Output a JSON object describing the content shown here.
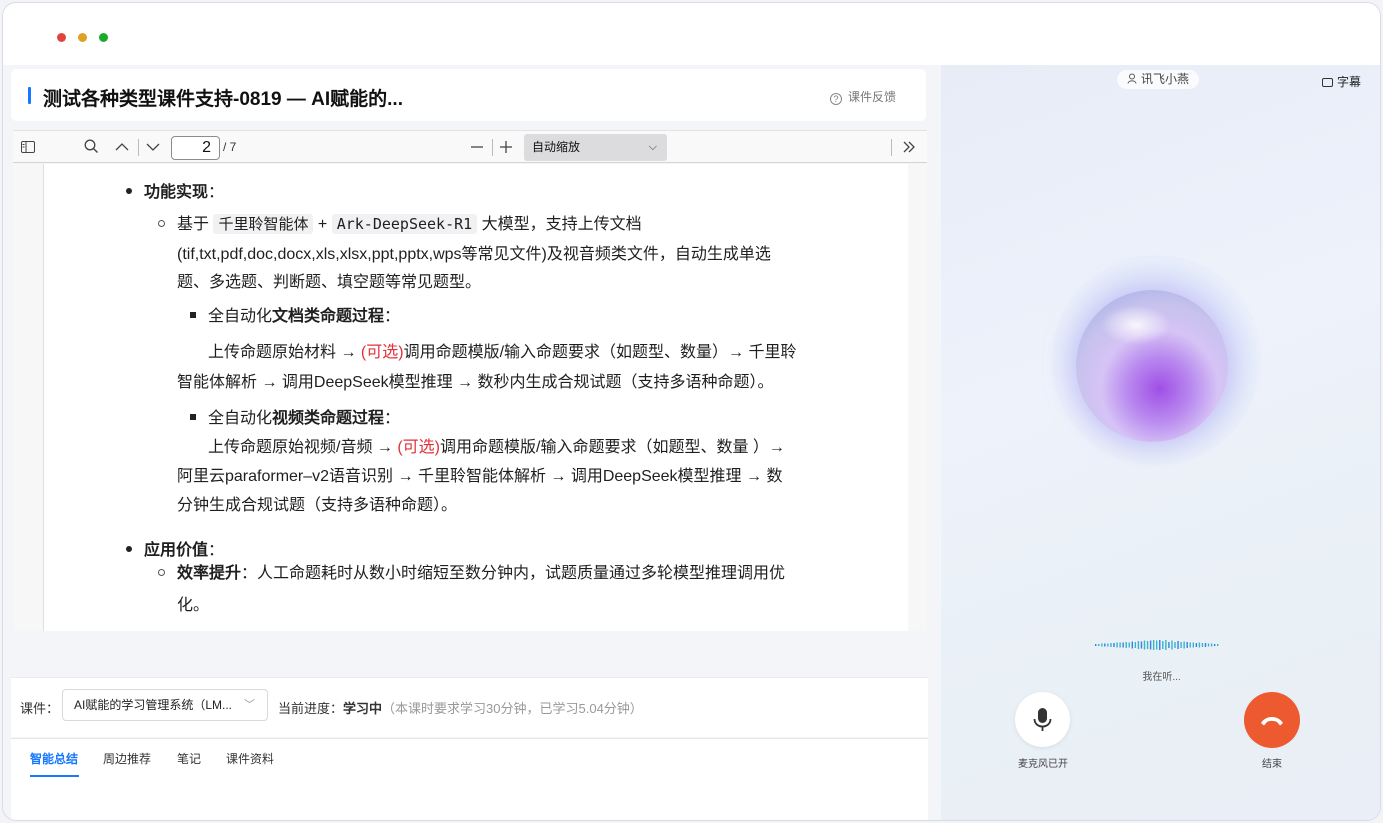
{
  "window": {
    "title": "测试各种类型课件支持-0819 — AI赋能的...",
    "feedback": "课件反馈"
  },
  "pdf_toolbar": {
    "page_current": "2",
    "page_total": "/ 7",
    "zoom": "自动缩放"
  },
  "document": {
    "lines": [
      {
        "kind": "disc",
        "segments": [
          {
            "t": "功能实现",
            "b": true
          },
          {
            "t": "："
          }
        ]
      },
      {
        "kind": "circ",
        "segments": [
          {
            "t": "基于 "
          },
          {
            "t": "千里聆智能体",
            "code": true
          },
          {
            "t": " + "
          },
          {
            "t": "Ark-DeepSeek-R1",
            "code": true
          },
          {
            "t": " 大模型，支持上传文档"
          }
        ]
      },
      {
        "kind": "text",
        "segments": [
          {
            "t": "(tif,txt,pdf,doc,docx,xls,xlsx,ppt,pptx,wps等常见文件)及视音频类文件，自动生成单选"
          }
        ]
      },
      {
        "kind": "text",
        "segments": [
          {
            "t": "题、多选题、判断题、填空题等常见题型。"
          }
        ]
      },
      {
        "kind": "sq",
        "segments": [
          {
            "t": "全自动化"
          },
          {
            "t": "文档类命题过程",
            "b": true
          },
          {
            "t": "："
          }
        ]
      },
      {
        "kind": "text",
        "segments": [
          {
            "t": "上传命题原始材料 → "
          },
          {
            "t": "(可选)",
            "red": true
          },
          {
            "t": "调用命题模版/输入命题要求（如题型、数量）→ 千里聆"
          }
        ]
      },
      {
        "kind": "text",
        "segments": [
          {
            "t": "智能体解析 → 调用DeepSeek模型推理 → 数秒内生成合规试题（支持多语种命题）。"
          }
        ]
      },
      {
        "kind": "sq",
        "segments": [
          {
            "t": "全自动化"
          },
          {
            "t": "视频类命题过程",
            "b": true
          },
          {
            "t": "："
          }
        ]
      },
      {
        "kind": "text",
        "segments": [
          {
            "t": "上传命题原始视频/音频 → "
          },
          {
            "t": "(可选)",
            "red": true
          },
          {
            "t": "调用命题模版/输入命题要求（如题型、数量 ）→"
          }
        ]
      },
      {
        "kind": "text",
        "segments": [
          {
            "t": "阿里云paraformer–v2语音识别  → 千里聆智能体解析  → 调用DeepSeek模型推理 → 数"
          }
        ]
      },
      {
        "kind": "text",
        "segments": [
          {
            "t": "分钟生成合规试题（支持多语种命题）。"
          }
        ]
      },
      {
        "kind": "disc",
        "segments": [
          {
            "t": "应用价值",
            "b": true
          },
          {
            "t": "："
          }
        ]
      },
      {
        "kind": "circ",
        "segments": [
          {
            "t": "效率提升",
            "b": true
          },
          {
            "t": "：人工命题耗时从数小时缩短至数分钟内，试题质量通过多轮模型推理调用优"
          }
        ]
      },
      {
        "kind": "text",
        "segments": [
          {
            "t": "化。"
          }
        ]
      }
    ]
  },
  "course_bar": {
    "label": "课件：",
    "selected": "AI赋能的学习管理系统（LM...",
    "progress_label": "当前进度：",
    "progress_status": "学习中",
    "progress_note": "（本课时要求学习30分钟，已学习5.04分钟）"
  },
  "tabs": [
    "智能总结",
    "周边推荐",
    "笔记",
    "课件资料"
  ],
  "assistant": {
    "name": "讯飞小燕",
    "subtitle_label": "字幕",
    "listening": "我在听...",
    "mic_label": "麦克风已开",
    "end_label": "结束"
  },
  "colors": {
    "accent": "#1677ff",
    "optional_red": "#e0303a",
    "end_call": "#ed5a2f"
  }
}
